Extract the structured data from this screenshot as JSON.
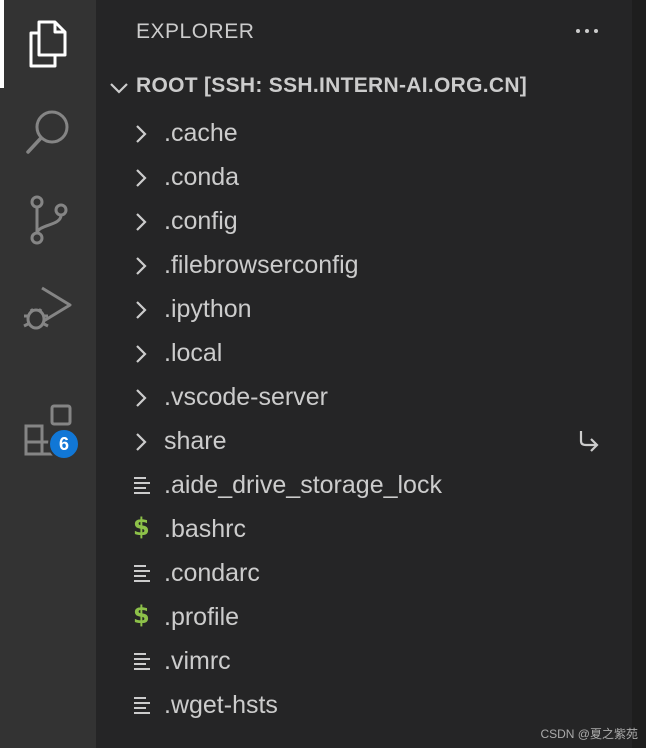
{
  "activity_bar": {
    "items": [
      {
        "name": "explorer",
        "icon": "files-icon",
        "active": true
      },
      {
        "name": "search",
        "icon": "search-icon"
      },
      {
        "name": "source-control",
        "icon": "source-control-icon"
      },
      {
        "name": "run-debug",
        "icon": "run-debug-icon"
      },
      {
        "name": "extensions",
        "icon": "extensions-icon",
        "badge": "6"
      }
    ]
  },
  "sidebar": {
    "title": "EXPLORER",
    "more_actions_icon": "ellipsis-icon",
    "root": {
      "label": "ROOT [SSH: SSH.INTERN-AI.ORG.CN]",
      "expanded": true
    },
    "folders": [
      {
        "label": ".cache"
      },
      {
        "label": ".conda"
      },
      {
        "label": ".config"
      },
      {
        "label": ".filebrowserconfig"
      },
      {
        "label": ".ipython"
      },
      {
        "label": ".local"
      },
      {
        "label": ".vscode-server"
      },
      {
        "label": "share",
        "symlink": true
      }
    ],
    "files": [
      {
        "label": ".aide_drive_storage_lock",
        "icon": "text-file-icon"
      },
      {
        "label": ".bashrc",
        "icon": "shell-dollar-icon"
      },
      {
        "label": ".condarc",
        "icon": "text-file-icon"
      },
      {
        "label": ".profile",
        "icon": "shell-dollar-icon"
      },
      {
        "label": ".vimrc",
        "icon": "text-file-icon"
      },
      {
        "label": ".wget-hsts",
        "icon": "text-file-icon"
      }
    ]
  },
  "watermark": "CSDN @夏之紫苑",
  "colors": {
    "activity_bar_bg": "#333333",
    "sidebar_bg": "#252526",
    "badge_bg": "#1177d6",
    "shell_icon": "#8dc149",
    "text": "#cccccc"
  }
}
